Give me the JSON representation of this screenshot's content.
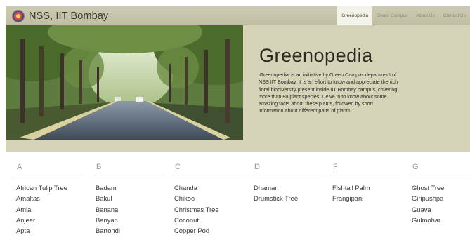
{
  "brand": {
    "name": "NSS, IIT Bombay",
    "logo_icon": "nss-logo-icon"
  },
  "nav": {
    "links": [
      {
        "label": "Greenopedia",
        "active": true
      },
      {
        "label": "Green Campus",
        "active": false
      },
      {
        "label": "About Us",
        "active": false
      },
      {
        "label": "Contact Us",
        "active": false
      }
    ]
  },
  "hero": {
    "title": "Greenopedia",
    "description": "'Greenopedia' is an initiative by Green Campus department of NSS IIT Bombay. It is an effort to know and appreciate the rich floral biodiversity present inside IIT Bombay campus, covering more than 80 plant species. Delve in to know about some amazing facts about these plants, followed by short information about different parts of plants!"
  },
  "index": {
    "columns": [
      {
        "letter": "A",
        "items": [
          "African Tulip Tree",
          "Amaltas",
          "Amla",
          "Anjeer",
          "Apta"
        ]
      },
      {
        "letter": "B",
        "items": [
          "Badam",
          "Bakul",
          "Banana",
          "Banyan",
          "Bartondi"
        ]
      },
      {
        "letter": "C",
        "items": [
          "Chanda",
          "Chikoo",
          "Christmas Tree",
          "Coconut",
          "Copper Pod"
        ]
      },
      {
        "letter": "D",
        "items": [
          "Dhaman",
          "Drumstick Tree"
        ]
      },
      {
        "letter": "F",
        "items": [
          "Fishtail Palm",
          "Frangipani"
        ]
      },
      {
        "letter": "G",
        "items": [
          "Ghost Tree",
          "Giripushpa",
          "Guava",
          "Gulmohar"
        ]
      }
    ]
  }
}
